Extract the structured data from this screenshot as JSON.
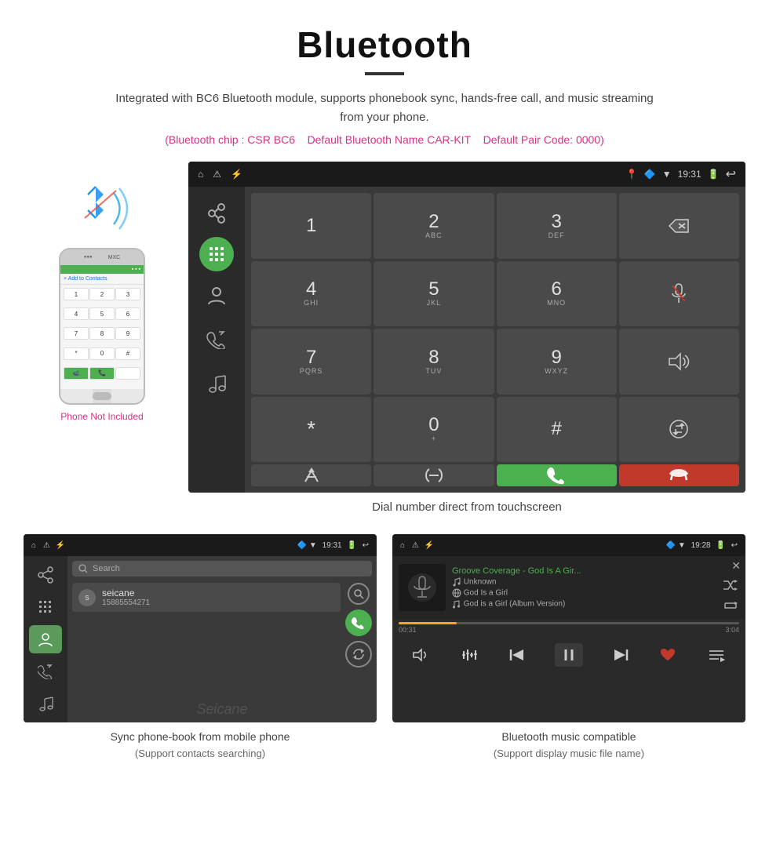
{
  "header": {
    "title": "Bluetooth",
    "description": "Integrated with BC6 Bluetooth module, supports phonebook sync, hands-free call, and music streaming from your phone.",
    "specs": {
      "chip": "(Bluetooth chip : CSR BC6",
      "name": "Default Bluetooth Name CAR-KIT",
      "code": "Default Pair Code: 0000)"
    }
  },
  "phone_section": {
    "not_included": "Phone Not Included"
  },
  "car_screen": {
    "status_left": [
      "△",
      "⚠",
      "⚡"
    ],
    "status_right": [
      "19:31"
    ],
    "dialpad": {
      "keys": [
        {
          "main": "1",
          "sub": ""
        },
        {
          "main": "2",
          "sub": "ABC"
        },
        {
          "main": "3",
          "sub": "DEF"
        },
        {
          "main": "⌫",
          "sub": "",
          "type": "backspace"
        },
        {
          "main": "4",
          "sub": "GHI"
        },
        {
          "main": "5",
          "sub": "JKL"
        },
        {
          "main": "6",
          "sub": "MNO"
        },
        {
          "main": "🎤",
          "sub": "",
          "type": "mute"
        },
        {
          "main": "7",
          "sub": "PQRS"
        },
        {
          "main": "8",
          "sub": "TUV"
        },
        {
          "main": "9",
          "sub": "WXYZ"
        },
        {
          "main": "🔊",
          "sub": "",
          "type": "volume"
        },
        {
          "main": "*",
          "sub": ""
        },
        {
          "main": "0",
          "sub": "+"
        },
        {
          "main": "#",
          "sub": ""
        },
        {
          "main": "⇅",
          "sub": "",
          "type": "swap"
        },
        {
          "main": "↑",
          "sub": "",
          "type": "merge"
        },
        {
          "main": "⇄",
          "sub": "",
          "type": "hold"
        },
        {
          "main": "📞",
          "sub": "",
          "type": "call-up"
        },
        {
          "main": "📵",
          "sub": "",
          "type": "call-end"
        }
      ]
    }
  },
  "dial_caption": "Dial number direct from touchscreen",
  "phonebook_screen": {
    "status_time": "19:31",
    "search_placeholder": "Search",
    "contact_letter": "s",
    "contact_name": "seicane",
    "contact_number": "15885554271",
    "watermark": "Seicane"
  },
  "music_screen": {
    "status_time": "19:28",
    "track_title": "Groove Coverage - God Is A Gir...",
    "artist": "Unknown",
    "album": "God Is a Girl",
    "version": "God is a Girl (Album Version)",
    "time_current": "00:31",
    "time_total": "3:04",
    "progress_percent": 17
  },
  "phonebook_caption": "Sync phone-book from mobile phone",
  "phonebook_caption_sub": "(Support contacts searching)",
  "music_caption": "Bluetooth music compatible",
  "music_caption_sub": "(Support display music file name)"
}
